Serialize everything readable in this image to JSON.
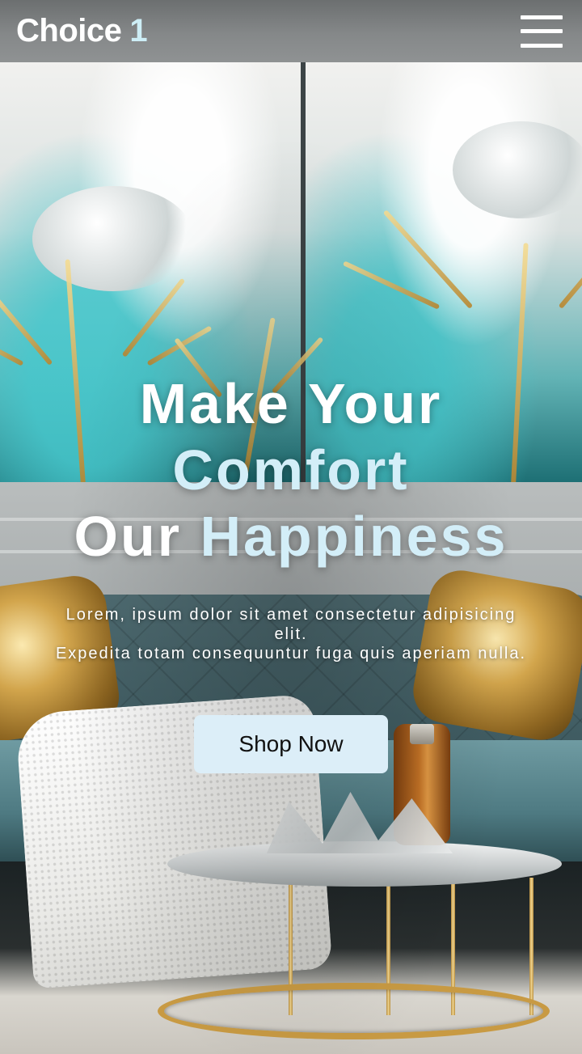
{
  "header": {
    "brand_text": "Choice",
    "brand_accent": "1",
    "menu_icon": "hamburger-menu-icon"
  },
  "hero": {
    "title_line1": "Make Your",
    "title_line2": "Comfort",
    "title_line3_a": "Our",
    "title_line3_b": "Happiness",
    "description_line1": "Lorem, ipsum dolor sit amet consectetur adipisicing elit.",
    "description_line2": "Expedita totam consequuntur fuga quis aperiam nulla.",
    "cta_label": "Shop Now"
  },
  "colors": {
    "header_bg": "#85888a",
    "accent_light_blue": "#d3eef8",
    "button_bg": "#dceef8",
    "text_white": "#ffffff"
  }
}
